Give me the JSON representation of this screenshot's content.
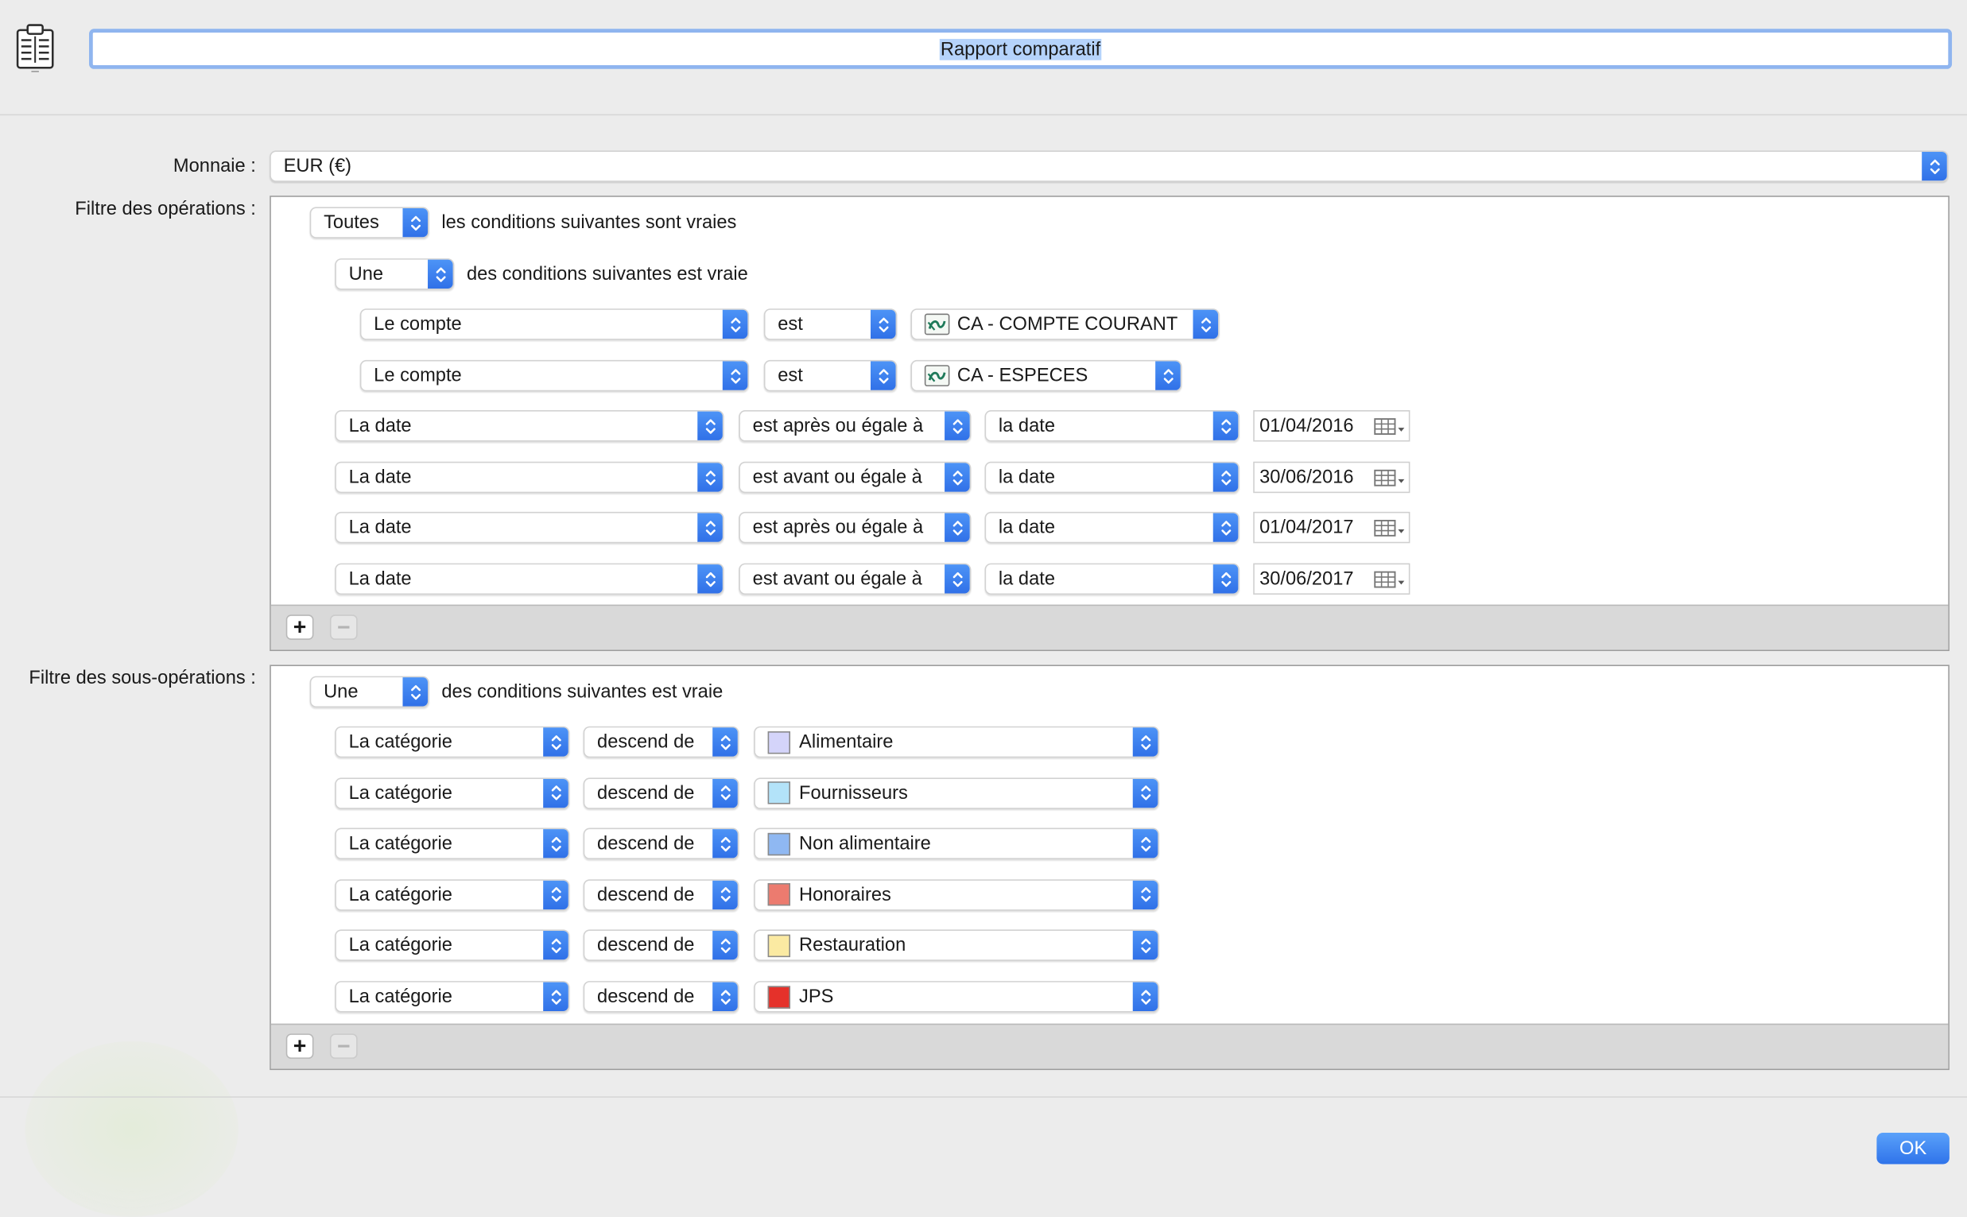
{
  "header": {
    "title": "Rapport comparatif",
    "report_icon": "report-document-icon"
  },
  "currency": {
    "label": "Monnaie :",
    "value": "EUR (€)"
  },
  "operations_filter": {
    "label": "Filtre des opérations :",
    "top": {
      "quantifier": "Toutes",
      "text": "les conditions suivantes sont vraies"
    },
    "group": {
      "quantifier": "Une",
      "text": "des conditions suivantes est vraie"
    },
    "account_rows": [
      {
        "field": "Le compte",
        "operator": "est",
        "value": "CA - COMPTE COURANT",
        "icon": "bank-logo-icon"
      },
      {
        "field": "Le compte",
        "operator": "est",
        "value": "CA - ESPECES",
        "icon": "bank-logo-icon"
      }
    ],
    "date_rows": [
      {
        "field": "La date",
        "operator": "est après ou égale à",
        "kind": "la date",
        "date": "01/04/2016"
      },
      {
        "field": "La date",
        "operator": "est avant ou égale à",
        "kind": "la date",
        "date": "30/06/2016"
      },
      {
        "field": "La date",
        "operator": "est après ou égale à",
        "kind": "la date",
        "date": "01/04/2017"
      },
      {
        "field": "La date",
        "operator": "est avant ou égale à",
        "kind": "la date",
        "date": "30/06/2017"
      }
    ],
    "add": "+",
    "remove": "−"
  },
  "suboperations_filter": {
    "label": "Filtre des sous-opérations :",
    "top": {
      "quantifier": "Une",
      "text": "des conditions suivantes est vraie"
    },
    "category_rows": [
      {
        "field": "La catégorie",
        "operator": "descend de",
        "value": "Alimentaire",
        "color": "#d4d4fa"
      },
      {
        "field": "La catégorie",
        "operator": "descend de",
        "value": "Fournisseurs",
        "color": "#b3e3f9"
      },
      {
        "field": "La catégorie",
        "operator": "descend de",
        "value": "Non alimentaire",
        "color": "#8fb8f2"
      },
      {
        "field": "La catégorie",
        "operator": "descend de",
        "value": "Honoraires",
        "color": "#ec7b6f"
      },
      {
        "field": "La catégorie",
        "operator": "descend de",
        "value": "Restauration",
        "color": "#fbeaa2"
      },
      {
        "field": "La catégorie",
        "operator": "descend de",
        "value": "JPS",
        "color": "#e5312a"
      }
    ],
    "add": "+",
    "remove": "−"
  },
  "ok_button": "OK",
  "colors": {
    "accent": "#2f73ea",
    "selection": "#b5d3fb"
  }
}
